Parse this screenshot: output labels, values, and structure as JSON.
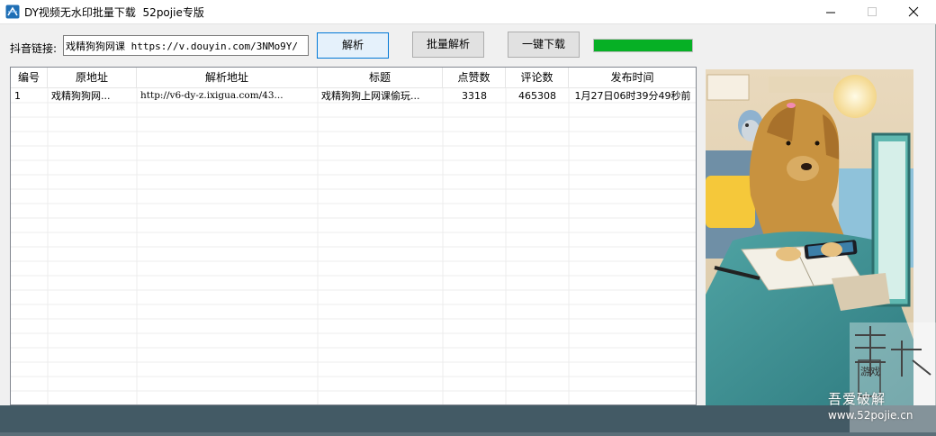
{
  "window": {
    "title": "DY视频无水印批量下载  52pojie专版"
  },
  "form": {
    "link_label": "抖音链接:",
    "link_value": "戏精狗狗网课 https://v.douyin.com/3NMo9Y/",
    "parse_button": "解析",
    "batch_button": "批量解析",
    "download_button": "一键下载",
    "progress_percent": 100
  },
  "table": {
    "columns": [
      "编号",
      "原地址",
      "解析地址",
      "标题",
      "点赞数",
      "评论数",
      "发布时间"
    ],
    "rows": [
      [
        "1",
        "戏精狗狗网...",
        "http://v6-dy-z.ixigua.com/43...",
        "戏精狗狗上网课偷玩...",
        "3318",
        "465308",
        "1月27日06时39分49秒前"
      ]
    ]
  },
  "watermark": {
    "tag": "游戏",
    "site_cn": "吾爱破解",
    "site_url": "www.52pojie.cn"
  },
  "colors": {
    "progress_green": "#06b025",
    "focus_blue": "#0078d7"
  }
}
